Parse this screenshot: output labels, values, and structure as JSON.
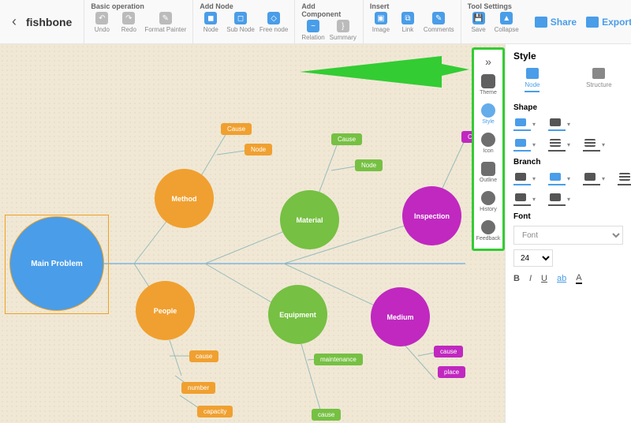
{
  "doc": {
    "title": "fishbone"
  },
  "toolbar": {
    "basic": {
      "title": "Basic operation",
      "undo": "Undo",
      "redo": "Redo",
      "format_painter": "Format Painter"
    },
    "add_node": {
      "title": "Add Node",
      "node": "Node",
      "sub_node": "Sub Node",
      "free_node": "Free node"
    },
    "add_component": {
      "title": "Add Component",
      "relation": "Relation",
      "summary": "Summary"
    },
    "insert": {
      "title": "Insert",
      "image": "Image",
      "link": "Link",
      "comments": "Comments"
    },
    "tool_settings": {
      "title": "Tool Settings",
      "save": "Save",
      "collapse": "Collapse"
    },
    "right": {
      "share": "Share",
      "export": "Export"
    }
  },
  "canvas": {
    "root": "Main Problem",
    "branches": [
      {
        "name": "Method",
        "color": "orange",
        "children": {
          "cause": "Cause",
          "node": "Node"
        }
      },
      {
        "name": "Material",
        "color": "green",
        "children": {
          "cause": "Cause",
          "node": "Node"
        }
      },
      {
        "name": "Inspection",
        "color": "purple",
        "children": {
          "cause": "Ca"
        }
      },
      {
        "name": "People",
        "color": "orange",
        "children": {
          "cause": "cause",
          "number": "number",
          "capacity": "capacity"
        }
      },
      {
        "name": "Equipment",
        "color": "green",
        "children": {
          "maintenance": "maintenance",
          "cause": "cause"
        }
      },
      {
        "name": "Medium",
        "color": "purple",
        "children": {
          "cause": "cause",
          "place": "place"
        }
      }
    ]
  },
  "rail": {
    "theme": "Theme",
    "style": "Style",
    "icon": "Icon",
    "outline": "Outline",
    "history": "History",
    "feedback": "Feedback"
  },
  "panel": {
    "title": "Style",
    "tabs": {
      "node": "Node",
      "structure": "Structure"
    },
    "shape": "Shape",
    "branch": "Branch",
    "font": "Font",
    "font_placeholder": "Font",
    "font_size": "24",
    "bold": "B",
    "italic": "I",
    "underline": "U",
    "ab": "ab",
    "color": "A"
  }
}
